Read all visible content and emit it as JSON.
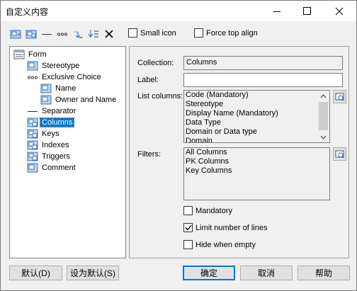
{
  "window": {
    "title": "自定义内容",
    "minimize_icon": "minimize-icon",
    "maximize_icon": "maximize-icon",
    "close_icon": "close-icon"
  },
  "toolbar": {
    "icons": [
      "add-item-icon",
      "add-items-icon",
      "add-separator-icon",
      "add-choice-icon",
      "move-down-icon",
      "move-bottom-icon",
      "delete-icon"
    ],
    "small_icon_label": "Small icon",
    "small_icon_checked": false,
    "force_top_align_label": "Force top align",
    "force_top_align_checked": false
  },
  "tree": {
    "items": [
      {
        "label": "Form",
        "icon": "form-icon",
        "depth": 0
      },
      {
        "label": "Stereotype",
        "icon": "attribute-icon",
        "depth": 1
      },
      {
        "label": "Exclusive Choice",
        "icon": "choice-icon",
        "depth": 1
      },
      {
        "label": "Name",
        "icon": "attribute-icon",
        "depth": 2
      },
      {
        "label": "Owner and Name",
        "icon": "attribute-icon",
        "depth": 2
      },
      {
        "label": "Separator",
        "icon": "separator-icon",
        "depth": 1
      },
      {
        "label": "Columns",
        "icon": "collection-icon",
        "depth": 1,
        "selected": true
      },
      {
        "label": "Keys",
        "icon": "collection-icon",
        "depth": 1
      },
      {
        "label": "Indexes",
        "icon": "collection-icon",
        "depth": 1
      },
      {
        "label": "Triggers",
        "icon": "collection-icon",
        "depth": 1
      },
      {
        "label": "Comment",
        "icon": "attribute-icon",
        "depth": 1
      }
    ]
  },
  "properties": {
    "collection_label": "Collection:",
    "collection_value": "Columns",
    "label_label": "Label:",
    "label_value": "",
    "list_columns_label": "List columns:",
    "list_columns": [
      "Code (Mandatory)",
      "Stereotype",
      "Display Name (Mandatory)",
      "Data Type",
      "Domain or Data type",
      "Domain"
    ],
    "filters_label": "Filters:",
    "filters": [
      "All Columns",
      "PK Columns",
      "Key Columns"
    ],
    "mandatory_label": "Mandatory",
    "mandatory_checked": false,
    "limit_lines_label": "Limit number of lines",
    "limit_lines_checked": true,
    "hide_empty_label": "Hide when empty",
    "hide_empty_checked": false,
    "select_button_icon": "properties-icon"
  },
  "buttons": {
    "default": "默认(D)",
    "set_default": "设为默认(S)",
    "ok": "确定",
    "cancel": "取消",
    "help": "帮助"
  }
}
